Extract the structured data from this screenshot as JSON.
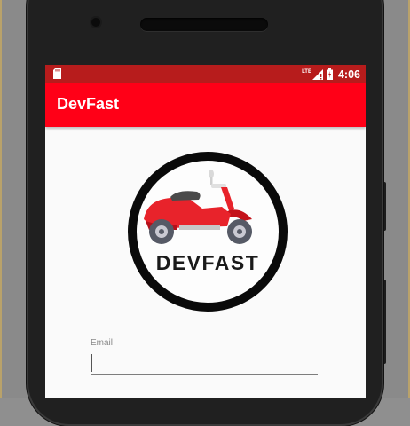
{
  "status_bar": {
    "network": "LTE",
    "time": "4:06",
    "icons": [
      "sd-card-icon",
      "signal-icon",
      "battery-icon"
    ],
    "color": "#b71c1c"
  },
  "app_bar": {
    "title": "DevFast",
    "color": "#ff0017"
  },
  "logo": {
    "text": "DEVFAST"
  },
  "form": {
    "email_label": "Email",
    "email_value": ""
  }
}
